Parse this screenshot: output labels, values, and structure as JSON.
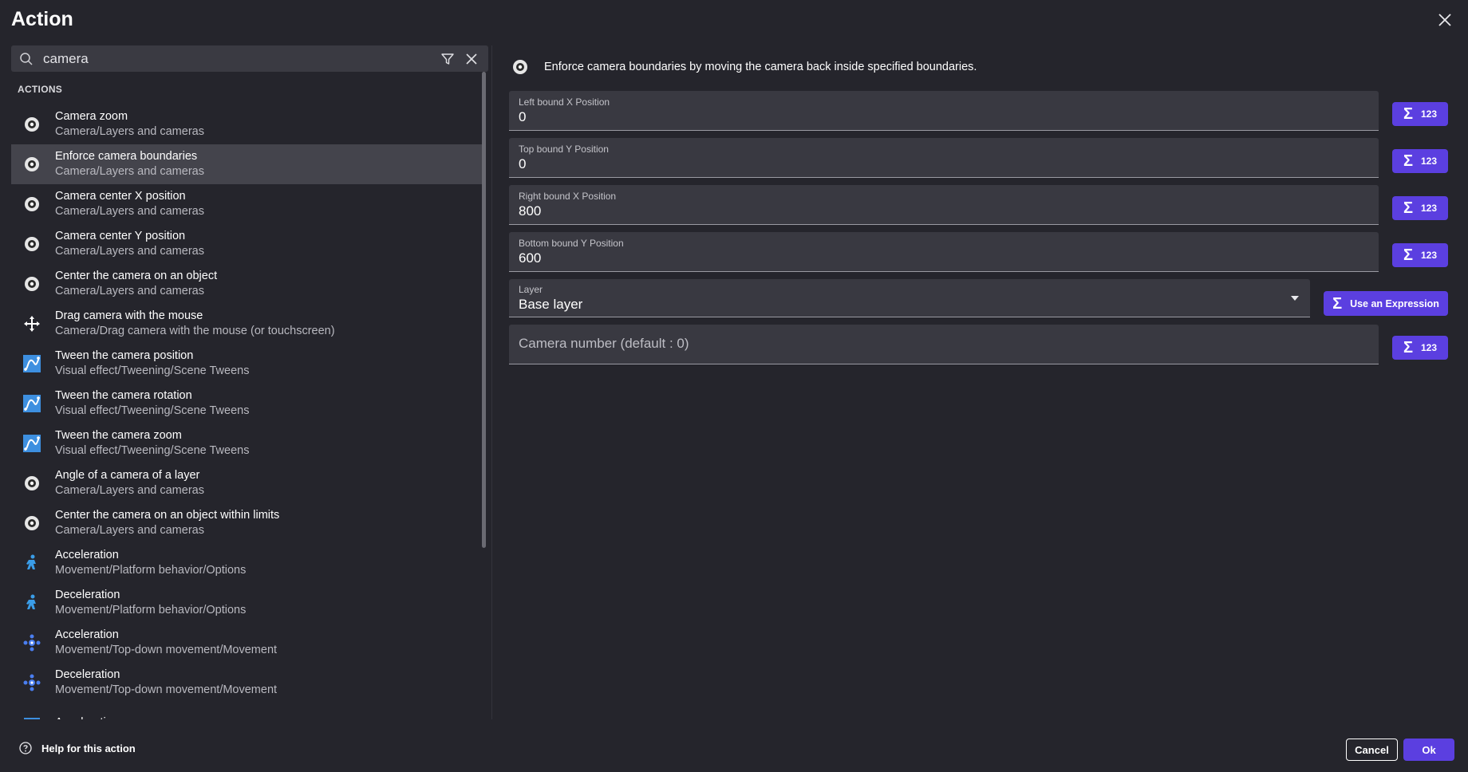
{
  "dialog": {
    "title": "Action"
  },
  "search": {
    "value": "camera",
    "placeholder": ""
  },
  "section_label": "ACTIONS",
  "actions": [
    {
      "title": "Camera zoom",
      "path": "Camera/Layers and cameras",
      "icon": "camera-icon",
      "selected": false
    },
    {
      "title": "Enforce camera boundaries",
      "path": "Camera/Layers and cameras",
      "icon": "camera-icon",
      "selected": true
    },
    {
      "title": "Camera center X position",
      "path": "Camera/Layers and cameras",
      "icon": "camera-icon",
      "selected": false
    },
    {
      "title": "Camera center Y position",
      "path": "Camera/Layers and cameras",
      "icon": "camera-icon",
      "selected": false
    },
    {
      "title": "Center the camera on an object",
      "path": "Camera/Layers and cameras",
      "icon": "camera-icon",
      "selected": false
    },
    {
      "title": "Drag camera with the mouse",
      "path": "Camera/Drag camera with the mouse (or touchscreen)",
      "icon": "drag-arrows-icon",
      "selected": false
    },
    {
      "title": "Tween the camera position",
      "path": "Visual effect/Tweening/Scene Tweens",
      "icon": "tween-icon",
      "selected": false
    },
    {
      "title": "Tween the camera rotation",
      "path": "Visual effect/Tweening/Scene Tweens",
      "icon": "tween-icon",
      "selected": false
    },
    {
      "title": "Tween the camera zoom",
      "path": "Visual effect/Tweening/Scene Tweens",
      "icon": "tween-icon",
      "selected": false
    },
    {
      "title": "Angle of a camera of a layer",
      "path": "Camera/Layers and cameras",
      "icon": "camera-icon",
      "selected": false
    },
    {
      "title": "Center the camera on an object within limits",
      "path": "Camera/Layers and cameras",
      "icon": "camera-icon",
      "selected": false
    },
    {
      "title": "Acceleration",
      "path": "Movement/Platform behavior/Options",
      "icon": "platformer-icon",
      "selected": false
    },
    {
      "title": "Deceleration",
      "path": "Movement/Platform behavior/Options",
      "icon": "platformer-icon",
      "selected": false
    },
    {
      "title": "Acceleration",
      "path": "Movement/Top-down movement/Movement",
      "icon": "topdown-icon",
      "selected": false
    },
    {
      "title": "Deceleration",
      "path": "Movement/Top-down movement/Movement",
      "icon": "topdown-icon",
      "selected": false
    },
    {
      "title": "Acceleration",
      "path": "",
      "icon": "generic-icon",
      "selected": false
    }
  ],
  "description": "Enforce camera boundaries by moving the camera back inside specified boundaries.",
  "params": [
    {
      "label": "Left bound X Position",
      "value": "0"
    },
    {
      "label": "Top bound Y Position",
      "value": "0"
    },
    {
      "label": "Right bound X Position",
      "value": "800"
    },
    {
      "label": "Bottom bound Y Position",
      "value": "600"
    }
  ],
  "layer": {
    "label": "Layer",
    "value": "Base layer"
  },
  "camera_number": {
    "placeholder": "Camera number (default : 0)"
  },
  "expr_button": {
    "sigma": "Σ",
    "label": "123"
  },
  "use_expression": {
    "sigma": "Σ",
    "label": "Use an Expression"
  },
  "footer": {
    "help": "Help for this action",
    "cancel": "Cancel",
    "ok": "Ok"
  },
  "colors": {
    "accent": "#5b3fe0",
    "background": "#25252c",
    "field": "#393941"
  }
}
